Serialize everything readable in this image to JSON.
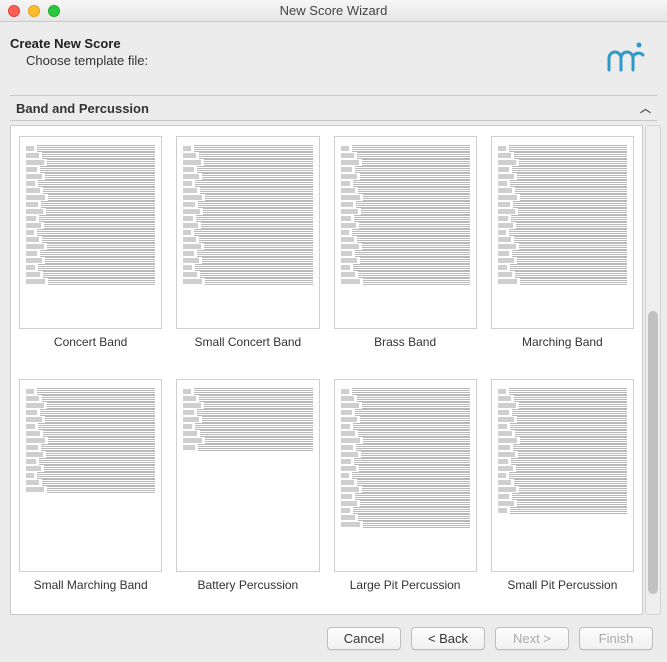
{
  "window": {
    "title": "New Score Wizard"
  },
  "header": {
    "heading": "Create New Score",
    "subheading": "Choose template file:"
  },
  "section": {
    "title": "Band and Percussion"
  },
  "templates": [
    {
      "label": "Concert Band",
      "staves": 20
    },
    {
      "label": "Small Concert Band",
      "staves": 20
    },
    {
      "label": "Brass Band",
      "staves": 20
    },
    {
      "label": "Marching Band",
      "staves": 20
    },
    {
      "label": "Small Marching Band",
      "staves": 15
    },
    {
      "label": "Battery Percussion",
      "staves": 9
    },
    {
      "label": "Large Pit Percussion",
      "staves": 20
    },
    {
      "label": "Small Pit Percussion",
      "staves": 18
    }
  ],
  "buttons": {
    "cancel": "Cancel",
    "back": "< Back",
    "next": "Next >",
    "finish": "Finish"
  },
  "colors": {
    "accent": "#2e9ac7"
  }
}
